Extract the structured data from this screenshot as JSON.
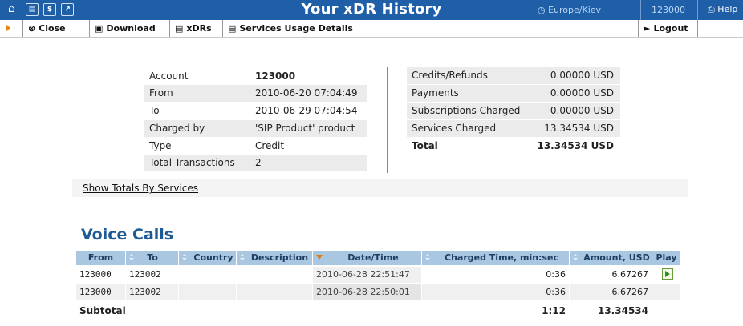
{
  "header": {
    "title": "Your xDR History",
    "timezone": "Europe/Kiev",
    "account": "123000",
    "help": "Help",
    "icons": [
      "home-icon",
      "list-icon",
      "dollar-icon",
      "chart-icon"
    ]
  },
  "toolbar": {
    "close": "Close",
    "download": "Download",
    "xdrs": "xDRs",
    "services_usage": "Services Usage Details",
    "logout": "Logout"
  },
  "account_info": [
    {
      "label": "Account",
      "value": "123000",
      "bold": true
    },
    {
      "label": "From",
      "value": "2010-06-20 07:04:49"
    },
    {
      "label": "To",
      "value": "2010-06-29 07:04:54"
    },
    {
      "label": "Charged by",
      "value": "'SIP Product' product"
    },
    {
      "label": "Type",
      "value": "Credit"
    },
    {
      "label": "Total Transactions",
      "value": "2"
    }
  ],
  "charges": [
    {
      "label": "Credits/Refunds",
      "value": "0.00000 USD"
    },
    {
      "label": "Payments",
      "value": "0.00000 USD"
    },
    {
      "label": "Subscriptions Charged",
      "value": "0.00000 USD"
    },
    {
      "label": "Services Charged",
      "value": "13.34534 USD"
    },
    {
      "label": "Total",
      "value": "13.34534 USD"
    }
  ],
  "totals_link": "Show Totals By Services",
  "section_title": "Voice Calls",
  "table": {
    "columns": [
      "From",
      "To",
      "Country",
      "Description",
      "Date/Time",
      "Charged Time, min:sec",
      "Amount, USD",
      "Play"
    ],
    "rows": [
      {
        "from": "123000",
        "to": "123002",
        "country": "",
        "description": "",
        "datetime": "2010-06-28 22:51:47",
        "charged_time": "0:36",
        "amount": "6.67267",
        "play": true
      },
      {
        "from": "123000",
        "to": "123002",
        "country": "",
        "description": "",
        "datetime": "2010-06-28 22:50:01",
        "charged_time": "0:36",
        "amount": "6.67267",
        "play": false
      }
    ],
    "subtotal": {
      "label": "Subtotal",
      "charged_time": "1:12",
      "amount": "13.34534"
    }
  },
  "colors": {
    "header_bg": "#1e5fa8",
    "section_title": "#1d5b97",
    "column_header_bg": "#a9c7e0",
    "accent_arrow": "#e08a10"
  }
}
